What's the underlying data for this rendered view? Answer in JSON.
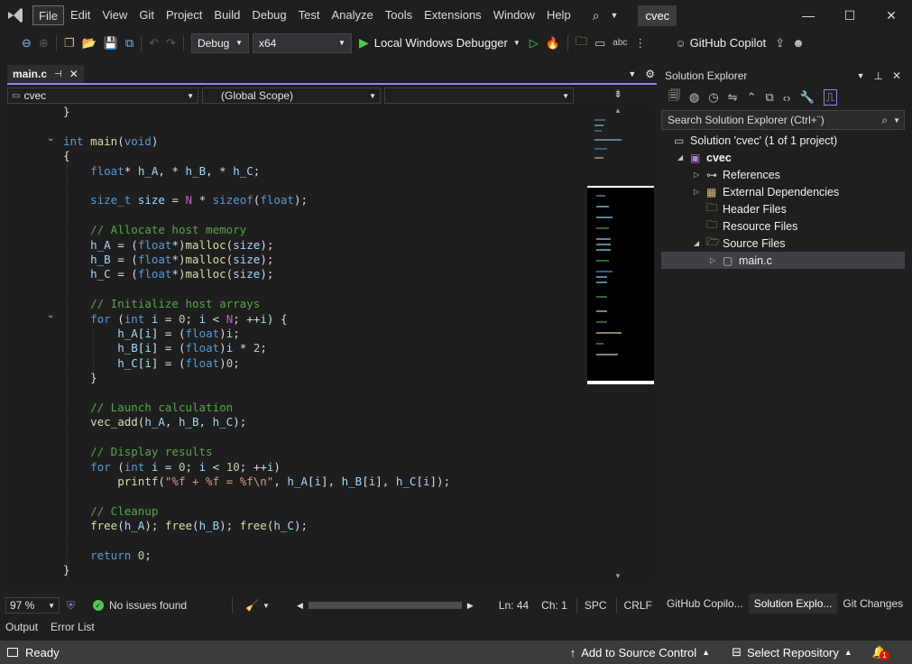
{
  "menu": [
    "File",
    "Edit",
    "View",
    "Git",
    "Project",
    "Build",
    "Debug",
    "Test",
    "Analyze",
    "Tools",
    "Extensions",
    "Window",
    "Help"
  ],
  "title": "cvec",
  "toolbar": {
    "config": "Debug",
    "platform": "x64",
    "run_label": "Local Windows Debugger",
    "copilot": "GitHub Copilot"
  },
  "tab": {
    "name": "main.c"
  },
  "nav": {
    "project": "cvec",
    "scope": "(Global Scope)"
  },
  "code": [
    "}",
    "",
    "int main(void)",
    "{",
    "    float* h_A, * h_B, * h_C;",
    "",
    "    size_t size = N * sizeof(float);",
    "",
    "    // Allocate host memory",
    "    h_A = (float*)malloc(size);",
    "    h_B = (float*)malloc(size);",
    "    h_C = (float*)malloc(size);",
    "",
    "    // Initialize host arrays",
    "    for (int i = 0; i < N; ++i) {",
    "        h_A[i] = (float)i;",
    "        h_B[i] = (float)i * 2;",
    "        h_C[i] = (float)0;",
    "    }",
    "",
    "    // Launch calculation",
    "    vec_add(h_A, h_B, h_C);",
    "",
    "    // Display results",
    "    for (int i = 0; i < 10; ++i)",
    "        printf(\"%f + %f = %f\\n\", h_A[i], h_B[i], h_C[i]);",
    "",
    "    // Cleanup",
    "    free(h_A); free(h_B); free(h_C);",
    "",
    "    return 0;",
    "}"
  ],
  "status": {
    "zoom": "97 %",
    "issues": "No issues found",
    "ln": "Ln: 44",
    "ch": "Ch: 1",
    "spc": "SPC",
    "crlf": "CRLF"
  },
  "output_tabs": [
    "Output",
    "Error List"
  ],
  "statusbar": {
    "ready": "Ready",
    "add_source": "Add to Source Control",
    "select_repo": "Select Repository",
    "notif_count": "1"
  },
  "solution_explorer": {
    "title": "Solution Explorer",
    "search_placeholder": "Search Solution Explorer (Ctrl+¨)",
    "items": [
      {
        "label": "Solution 'cvec' (1 of 1 project)",
        "level": 0
      },
      {
        "label": "cvec",
        "level": 1
      },
      {
        "label": "References",
        "level": 2
      },
      {
        "label": "External Dependencies",
        "level": 2
      },
      {
        "label": "Header Files",
        "level": 2
      },
      {
        "label": "Resource Files",
        "level": 2
      },
      {
        "label": "Source Files",
        "level": 2
      },
      {
        "label": "main.c",
        "level": 3
      }
    ],
    "tabs": [
      "GitHub Copilo...",
      "Solution Explo...",
      "Git Changes"
    ]
  }
}
